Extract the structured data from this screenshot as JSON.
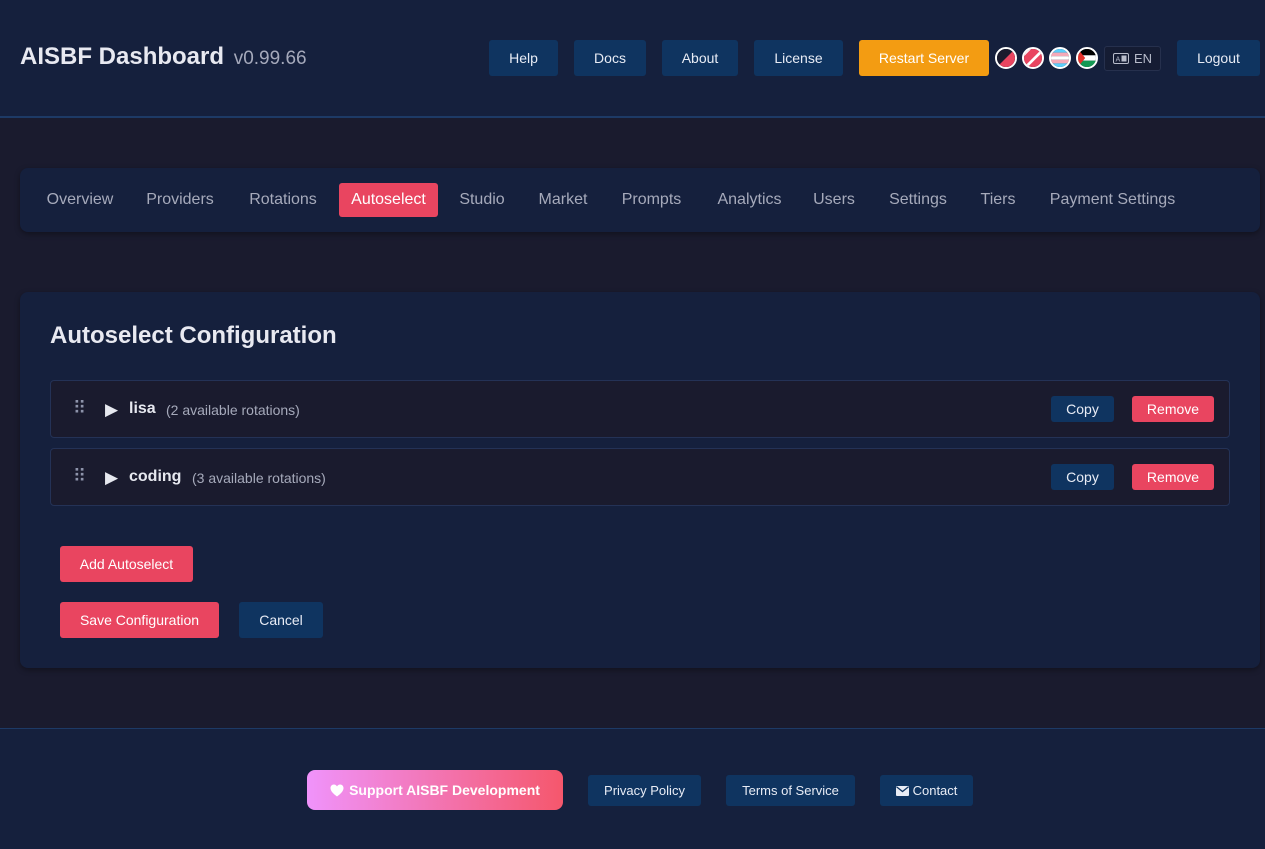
{
  "header": {
    "title": "AISBF Dashboard",
    "version": "v0.99.66",
    "buttons": {
      "help": "Help",
      "docs": "Docs",
      "about": "About",
      "license": "License",
      "restart": "Restart Server",
      "logout": "Logout"
    },
    "language": "EN",
    "flag_icons": [
      "theme-flag-icon",
      "flag-icon",
      "trans-flag-icon",
      "palestine-flag-icon"
    ]
  },
  "nav": {
    "tabs": [
      {
        "label": "Overview"
      },
      {
        "label": "Providers"
      },
      {
        "label": "Rotations"
      },
      {
        "label": "Autoselect",
        "active": true
      },
      {
        "label": "Studio"
      },
      {
        "label": "Market"
      },
      {
        "label": "Prompts"
      },
      {
        "label": "Analytics"
      },
      {
        "label": "Users"
      },
      {
        "label": "Settings"
      },
      {
        "label": "Tiers"
      },
      {
        "label": "Payment Settings"
      }
    ]
  },
  "main": {
    "title": "Autoselect Configuration",
    "items": [
      {
        "name": "lisa",
        "info": "(2 available rotations)",
        "copy": "Copy",
        "remove": "Remove"
      },
      {
        "name": "coding",
        "info": "(3 available rotations)",
        "copy": "Copy",
        "remove": "Remove"
      }
    ],
    "add_label": "Add Autoselect",
    "save_label": "Save Configuration",
    "cancel_label": "Cancel"
  },
  "footer": {
    "support": "Support AISBF Development",
    "privacy": "Privacy Policy",
    "terms": "Terms of Service",
    "contact": "Contact"
  },
  "colors": {
    "background": "#1a1b2e",
    "panel": "#15203d",
    "accent": "#e94560",
    "secondary": "#0f3460",
    "warning": "#f39c12"
  }
}
